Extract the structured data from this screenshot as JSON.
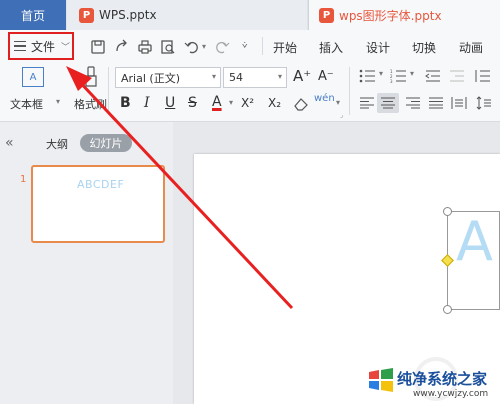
{
  "tabs": {
    "home": "首页",
    "doc1": "WPS.pptx",
    "doc2": "wps图形字体.pptx"
  },
  "menu": {
    "file": "文件",
    "items": [
      "开始",
      "插入",
      "设计",
      "切换",
      "动画"
    ]
  },
  "ribbon": {
    "textbox_label": "文本框",
    "format_painter_label": "格式刷",
    "font_name": "Arial (正文)",
    "font_size": "54",
    "bold": "B",
    "italic": "I",
    "underline": "U",
    "strikethrough": "S",
    "font_color": "A",
    "superscript": "X²",
    "subscript": "X₂",
    "grow_font": "A⁺",
    "shrink_font": "A⁻"
  },
  "left_panel": {
    "outline_tab": "大纲",
    "slides_tab": "幻灯片",
    "slide_number": "1",
    "thumbnail_text": "ABCDEF"
  },
  "canvas": {
    "letter": "A"
  },
  "watermark": {
    "main": "纯净系统之家",
    "sub": "www.ycwjzy.com"
  },
  "colors": {
    "home_tab": "#3f6fb6",
    "highlight_box": "#e02020",
    "arrow": "#e82020",
    "ppt_icon": "#e8563c",
    "wordart": "#b5dcf5"
  }
}
